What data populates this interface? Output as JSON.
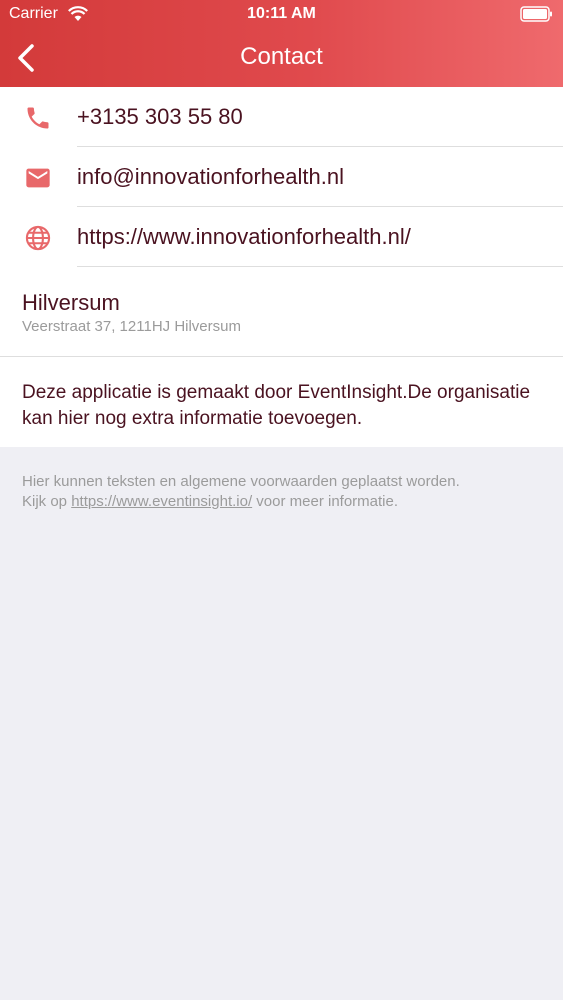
{
  "status_bar": {
    "carrier": "Carrier",
    "time": "10:11 AM"
  },
  "nav": {
    "title": "Contact"
  },
  "contact": {
    "phone": "+3135 303 55 80",
    "email": "info@innovationforhealth.nl",
    "website": "https://www.innovationforhealth.nl/"
  },
  "location": {
    "name": "Hilversum",
    "address": "Veerstraat 37, 1211HJ Hilversum"
  },
  "info": {
    "text": "Deze applicatie is gemaakt door EventInsight.De organisatie kan hier nog extra informatie toevoegen."
  },
  "footer": {
    "line1": "Hier kunnen teksten en algemene voorwaarden geplaatst worden.",
    "prefix": "Kijk op ",
    "link": "https://www.eventinsight.io/",
    "suffix": " voor meer informatie."
  },
  "colors": {
    "header_start": "#d33a3a",
    "header_end": "#ef6a6d",
    "icon": "#e8686a",
    "text": "#4a1220",
    "muted": "#9b9b9b",
    "background": "#efeff4"
  },
  "icons": {
    "phone": "phone-icon",
    "email": "mail-icon",
    "website": "globe-icon",
    "back": "chevron-left-icon"
  }
}
